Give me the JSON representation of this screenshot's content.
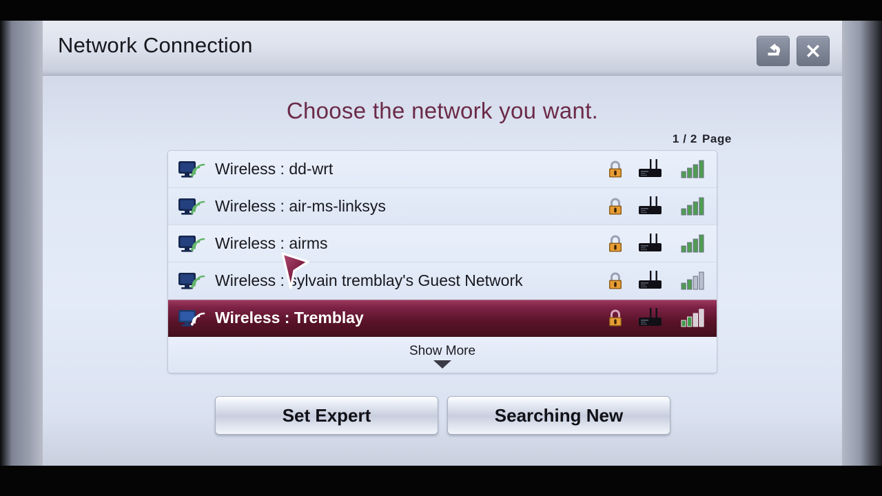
{
  "window": {
    "title": "Network Connection",
    "back_icon": "back-arrow-icon",
    "close_icon": "close-icon"
  },
  "heading": "Choose the network you want.",
  "page_indicator": {
    "value": "1 / 2",
    "label": "Page"
  },
  "networks": [
    {
      "label": "Wireless : dd-wrt",
      "device_icon": "tv-wifi-icon",
      "lock_icon": "lock-icon",
      "router_icon": "router-icon",
      "signal_icon": "signal-bars-icon",
      "signal_bars": 4,
      "selected": false
    },
    {
      "label": "Wireless : air-ms-linksys",
      "device_icon": "tv-wifi-icon",
      "lock_icon": "lock-icon",
      "router_icon": "router-icon",
      "signal_icon": "signal-bars-icon",
      "signal_bars": 4,
      "selected": false
    },
    {
      "label": "Wireless : airms",
      "device_icon": "tv-wifi-icon",
      "lock_icon": "lock-icon",
      "router_icon": "router-icon",
      "signal_icon": "signal-bars-icon",
      "signal_bars": 4,
      "selected": false
    },
    {
      "label": "Wireless : sylvain tremblay's Guest Network",
      "device_icon": "tv-wifi-icon",
      "lock_icon": "lock-icon",
      "router_icon": "router-icon",
      "signal_icon": "signal-bars-icon",
      "signal_bars": 2,
      "selected": false
    },
    {
      "label": "Wireless : Tremblay",
      "device_icon": "tv-wifi-icon",
      "lock_icon": "lock-icon",
      "router_icon": "router-icon",
      "signal_icon": "signal-bars-icon",
      "signal_bars": 2,
      "selected": true
    }
  ],
  "show_more": {
    "label": "Show More",
    "arrow_icon": "chevron-down-icon"
  },
  "buttons": {
    "set_expert": "Set Expert",
    "searching_new": "Searching New"
  },
  "cursor": {
    "icon": "mouse-pointer-icon"
  },
  "colors": {
    "accent_maroon": "#6b2a48",
    "selected_row": "#7c2244",
    "signal_green": "#4f9c52",
    "lock_orange": "#e08a2a",
    "dialog_bg": "#e4ebf8"
  }
}
